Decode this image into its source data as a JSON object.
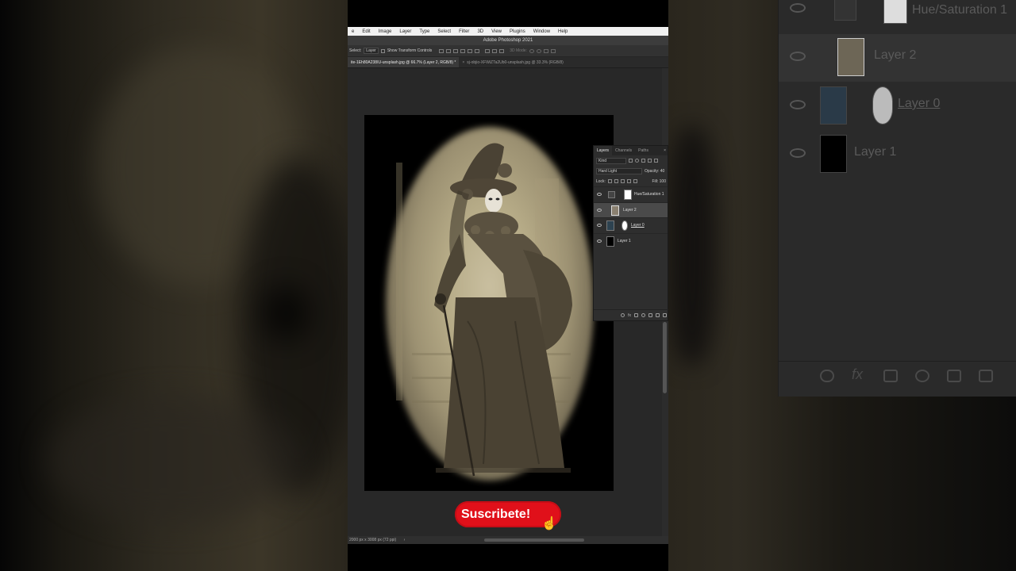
{
  "menu": [
    "e",
    "Edit",
    "Image",
    "Layer",
    "Type",
    "Select",
    "Filter",
    "3D",
    "View",
    "Plugins",
    "Window",
    "Help"
  ],
  "app_title": "Adobe Photoshop 2021",
  "options_bar": {
    "select_label": "Select:",
    "select_value": "Layer",
    "transform_label": "Show Transform Controls",
    "mode_label": "3D Mode:"
  },
  "tabs": [
    {
      "label": "ite-1Eh80A238IU-unsplash.jpg @ 66.7% (Layer 2, RGB/8) *",
      "active": true
    },
    {
      "label": "sj-objio-XFWiZTa2Ub0-unsplash.jpg @ 33.3% (RGB/8)",
      "active": false,
      "close": "×"
    }
  ],
  "layers_panel": {
    "tabs": [
      "Layers",
      "Channels",
      "Paths"
    ],
    "close": "×",
    "filter_value": "Kind",
    "blend_mode": "Hard Light",
    "opacity_label": "Opacity: 40",
    "lock_label": "Lock:",
    "fill_label": "Fill: 100",
    "layers": [
      {
        "name": "Hue/Saturation 1",
        "selected": false
      },
      {
        "name": "Layer 2",
        "selected": true
      },
      {
        "name": "Layer 0",
        "selected": false
      },
      {
        "name": "Layer 1",
        "selected": false
      }
    ],
    "fx_label": "fx"
  },
  "status_bar": {
    "text": "2000 px x 3008 px (72 ppi)",
    "chevron": "›"
  },
  "subscribe": {
    "label": "Suscribete!",
    "hand": "☝"
  },
  "mirror_panel": {
    "layers": [
      "Hue/Saturation 1",
      "Layer 2",
      "Layer 0",
      "Layer 1"
    ],
    "fx_label": "fx"
  },
  "colors": {
    "sepia_light": "#c9bfa0",
    "sepia_dark": "#6f6650",
    "subscribe_red": "#e0101a",
    "ps_panel": "#2e2e2e"
  }
}
